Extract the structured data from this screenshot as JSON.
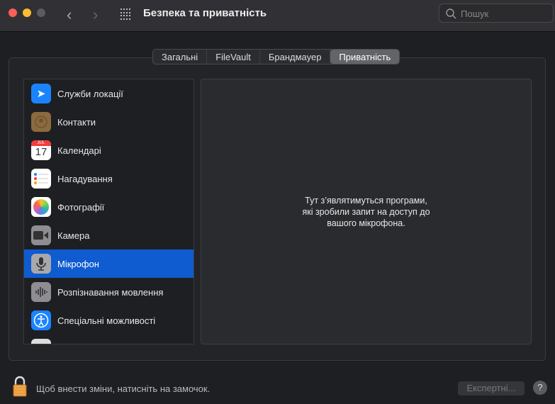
{
  "window": {
    "title": "Безпека та приватність",
    "search_placeholder": "Пошук"
  },
  "tabs": [
    {
      "label": "Загальні"
    },
    {
      "label": "FileVault"
    },
    {
      "label": "Брандмауер"
    },
    {
      "label": "Приватність",
      "active": true
    }
  ],
  "list": [
    {
      "label": "Служби локації",
      "icon": "location-arrow-icon"
    },
    {
      "label": "Контакти",
      "icon": "contacts-icon"
    },
    {
      "label": "Календарі",
      "icon": "calendar-icon",
      "month": "JUL",
      "day": "17"
    },
    {
      "label": "Нагадування",
      "icon": "reminders-icon"
    },
    {
      "label": "Фотографії",
      "icon": "photos-icon"
    },
    {
      "label": "Камера",
      "icon": "camera-icon"
    },
    {
      "label": "Мікрофон",
      "icon": "microphone-icon",
      "selected": true
    },
    {
      "label": "Розпізнавання мовлення",
      "icon": "speech-waveform-icon"
    },
    {
      "label": "Спеціальні можливості",
      "icon": "accessibility-icon"
    }
  ],
  "detail": {
    "line1": "Тут з’являтимуться програми,",
    "line2": "які зробили запит на доступ до",
    "line3": "вашого мікрофона."
  },
  "footer": {
    "lock_text": "Щоб внести зміни, натисніть на замочок.",
    "advanced_label": "Експертні...",
    "help_label": "?"
  },
  "colors": {
    "selection": "#0f5bd0",
    "close": "#ff5f57",
    "minimize": "#febc2e"
  }
}
